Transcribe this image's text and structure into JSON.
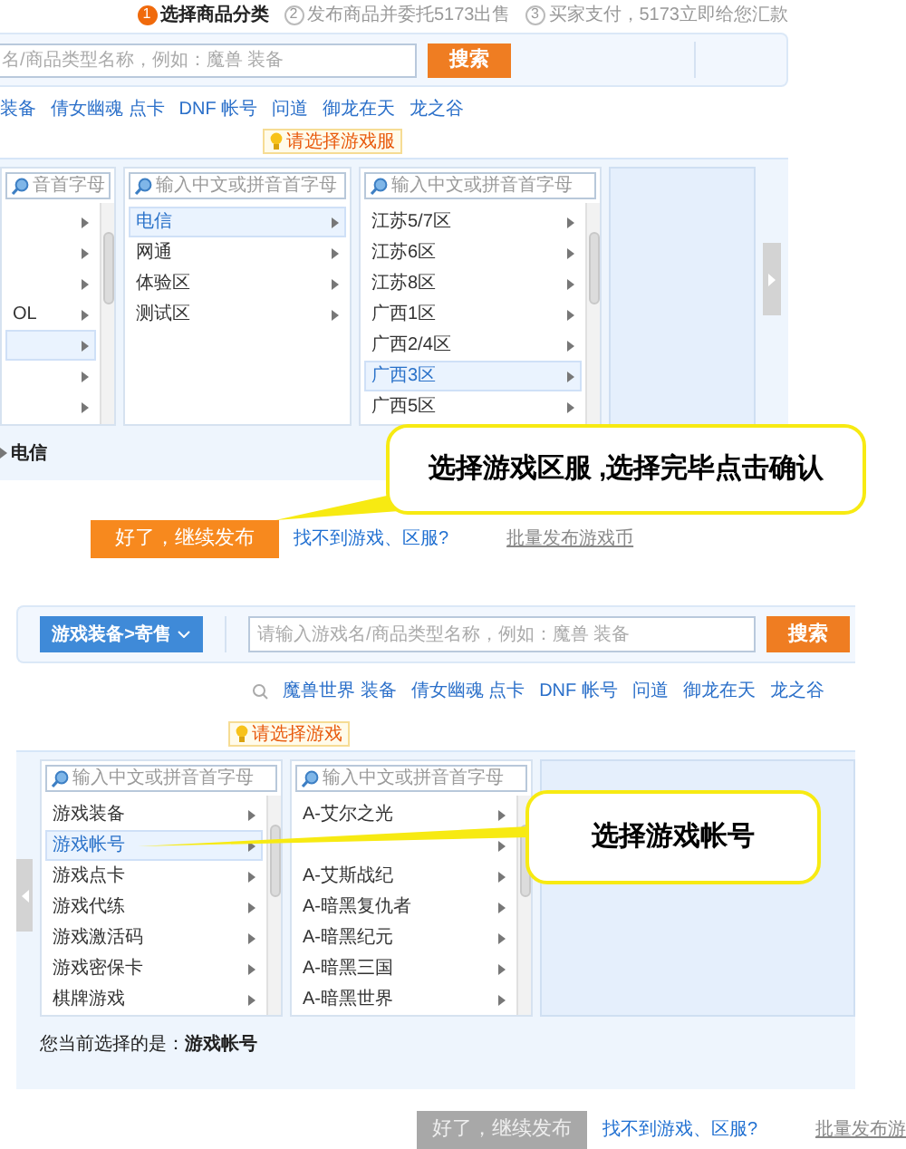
{
  "upper_screenshot": {
    "steps": [
      {
        "number": "1",
        "label": "选择商品分类",
        "selected": true
      },
      {
        "number": "2",
        "label": "发布商品并委托5173出售",
        "selected": false
      },
      {
        "number": "3",
        "label": "买家支付，5173立即给您汇款",
        "selected": false
      }
    ],
    "search": {
      "placeholder": "名/商品类型名称，例如：魔兽 装备",
      "button": "搜索"
    },
    "hot_links": [
      "装备",
      "倩女幽魂 点卡",
      "DNF 帐号",
      "问道",
      "御龙在天",
      "龙之谷"
    ],
    "tooltip": "请选择游戏服",
    "columns": [
      {
        "placeholder": "音首字母",
        "items": [
          {
            "selected": false
          },
          {
            "selected": false
          },
          {
            "selected": false
          },
          {
            "label": "OL",
            "selected": false
          },
          {
            "selected": true
          },
          {
            "selected": false
          },
          {
            "selected": false
          }
        ]
      },
      {
        "placeholder": "输入中文或拼音首字母",
        "items": [
          {
            "label": "电信",
            "selected": true
          },
          {
            "label": "网通",
            "selected": false
          },
          {
            "label": "体验区",
            "selected": false
          },
          {
            "label": "测试区",
            "selected": false
          }
        ]
      },
      {
        "placeholder": "输入中文或拼音首字母",
        "items": [
          {
            "label": "江苏5/7区",
            "selected": false
          },
          {
            "label": "江苏6区",
            "selected": false
          },
          {
            "label": "江苏8区",
            "selected": false
          },
          {
            "label": "广西1区",
            "selected": false
          },
          {
            "label": "广西2/4区",
            "selected": false
          },
          {
            "label": "广西3区",
            "selected": true
          },
          {
            "label": "广西5区",
            "selected": false
          }
        ]
      }
    ],
    "current_selection": "电信",
    "callout": "选择游戏区服 ,选择完毕点击确认",
    "primary_button": {
      "label": "好了，继续发布",
      "disabled": false
    },
    "links": [
      "找不到游戏、区服?",
      "批量发布游戏币"
    ]
  },
  "lower_screenshot": {
    "category_dropdown": "游戏装备>寄售",
    "search": {
      "placeholder": "请输入游戏名/商品类型名称，例如：魔兽 装备",
      "button": "搜索"
    },
    "hot_links": [
      "魔兽世界 装备",
      "倩女幽魂 点卡",
      "DNF 帐号",
      "问道",
      "御龙在天",
      "龙之谷"
    ],
    "tooltip": "请选择游戏",
    "columns": [
      {
        "placeholder": "输入中文或拼音首字母",
        "items": [
          {
            "label": "游戏装备",
            "selected": false
          },
          {
            "label": "游戏帐号",
            "selected": true
          },
          {
            "label": "游戏点卡",
            "selected": false
          },
          {
            "label": "游戏代练",
            "selected": false
          },
          {
            "label": "游戏激活码",
            "selected": false
          },
          {
            "label": "游戏密保卡",
            "selected": false
          },
          {
            "label": "棋牌游戏",
            "selected": false
          }
        ]
      },
      {
        "placeholder": "输入中文或拼音首字母",
        "items": [
          {
            "label": "A-艾尔之光",
            "selected": false
          },
          {
            "selected": false
          },
          {
            "label": "A-艾斯战纪",
            "selected": false
          },
          {
            "label": "A-暗黑复仇者",
            "selected": false
          },
          {
            "label": "A-暗黑纪元",
            "selected": false
          },
          {
            "label": "A-暗黑三国",
            "selected": false
          },
          {
            "label": "A-暗黑世界",
            "selected": false
          }
        ]
      }
    ],
    "current_selection": "您当前选择的是：**游戏帐号**",
    "callout": "选择游戏帐号",
    "primary_button": {
      "label": "好了，继续发布",
      "disabled": true
    },
    "links": [
      "找不到游戏、区服?",
      "批量发布游"
    ]
  }
}
